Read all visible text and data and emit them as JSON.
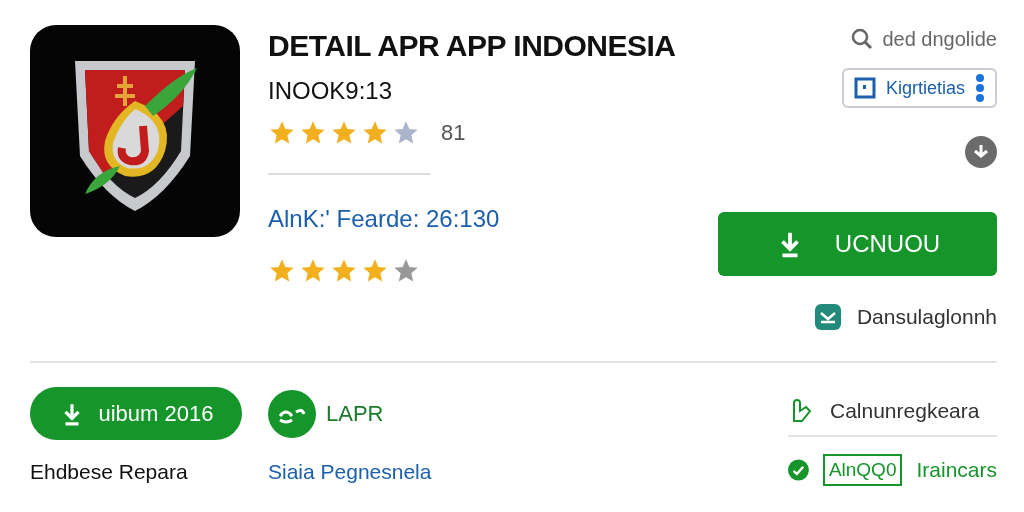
{
  "app": {
    "title": "DETAIL APR APP INDONESIA",
    "subtitle": "INOOK9:13",
    "rating": {
      "stars": 4,
      "count": "81"
    },
    "info": "AlnK:' Fearde: 26:130",
    "rating_2": {
      "stars": 4
    }
  },
  "search": {
    "text": "ded dngolide"
  },
  "action_chip": {
    "label": "Kigrtietias"
  },
  "install_button": {
    "label": "UCNUOU"
  },
  "side_link": {
    "label": "Dansulaglonnh"
  },
  "release": {
    "badge": "uibum 2016",
    "caption": "Ehdbese Repara"
  },
  "publisher": {
    "name": "LAPR",
    "link": "Siaia Pegnesnela"
  },
  "details": [
    {
      "kind": "text",
      "label": "Calnunregkeara"
    },
    {
      "kind": "tagged",
      "tag": "AlnQQ0",
      "label": "Iraincars"
    }
  ]
}
